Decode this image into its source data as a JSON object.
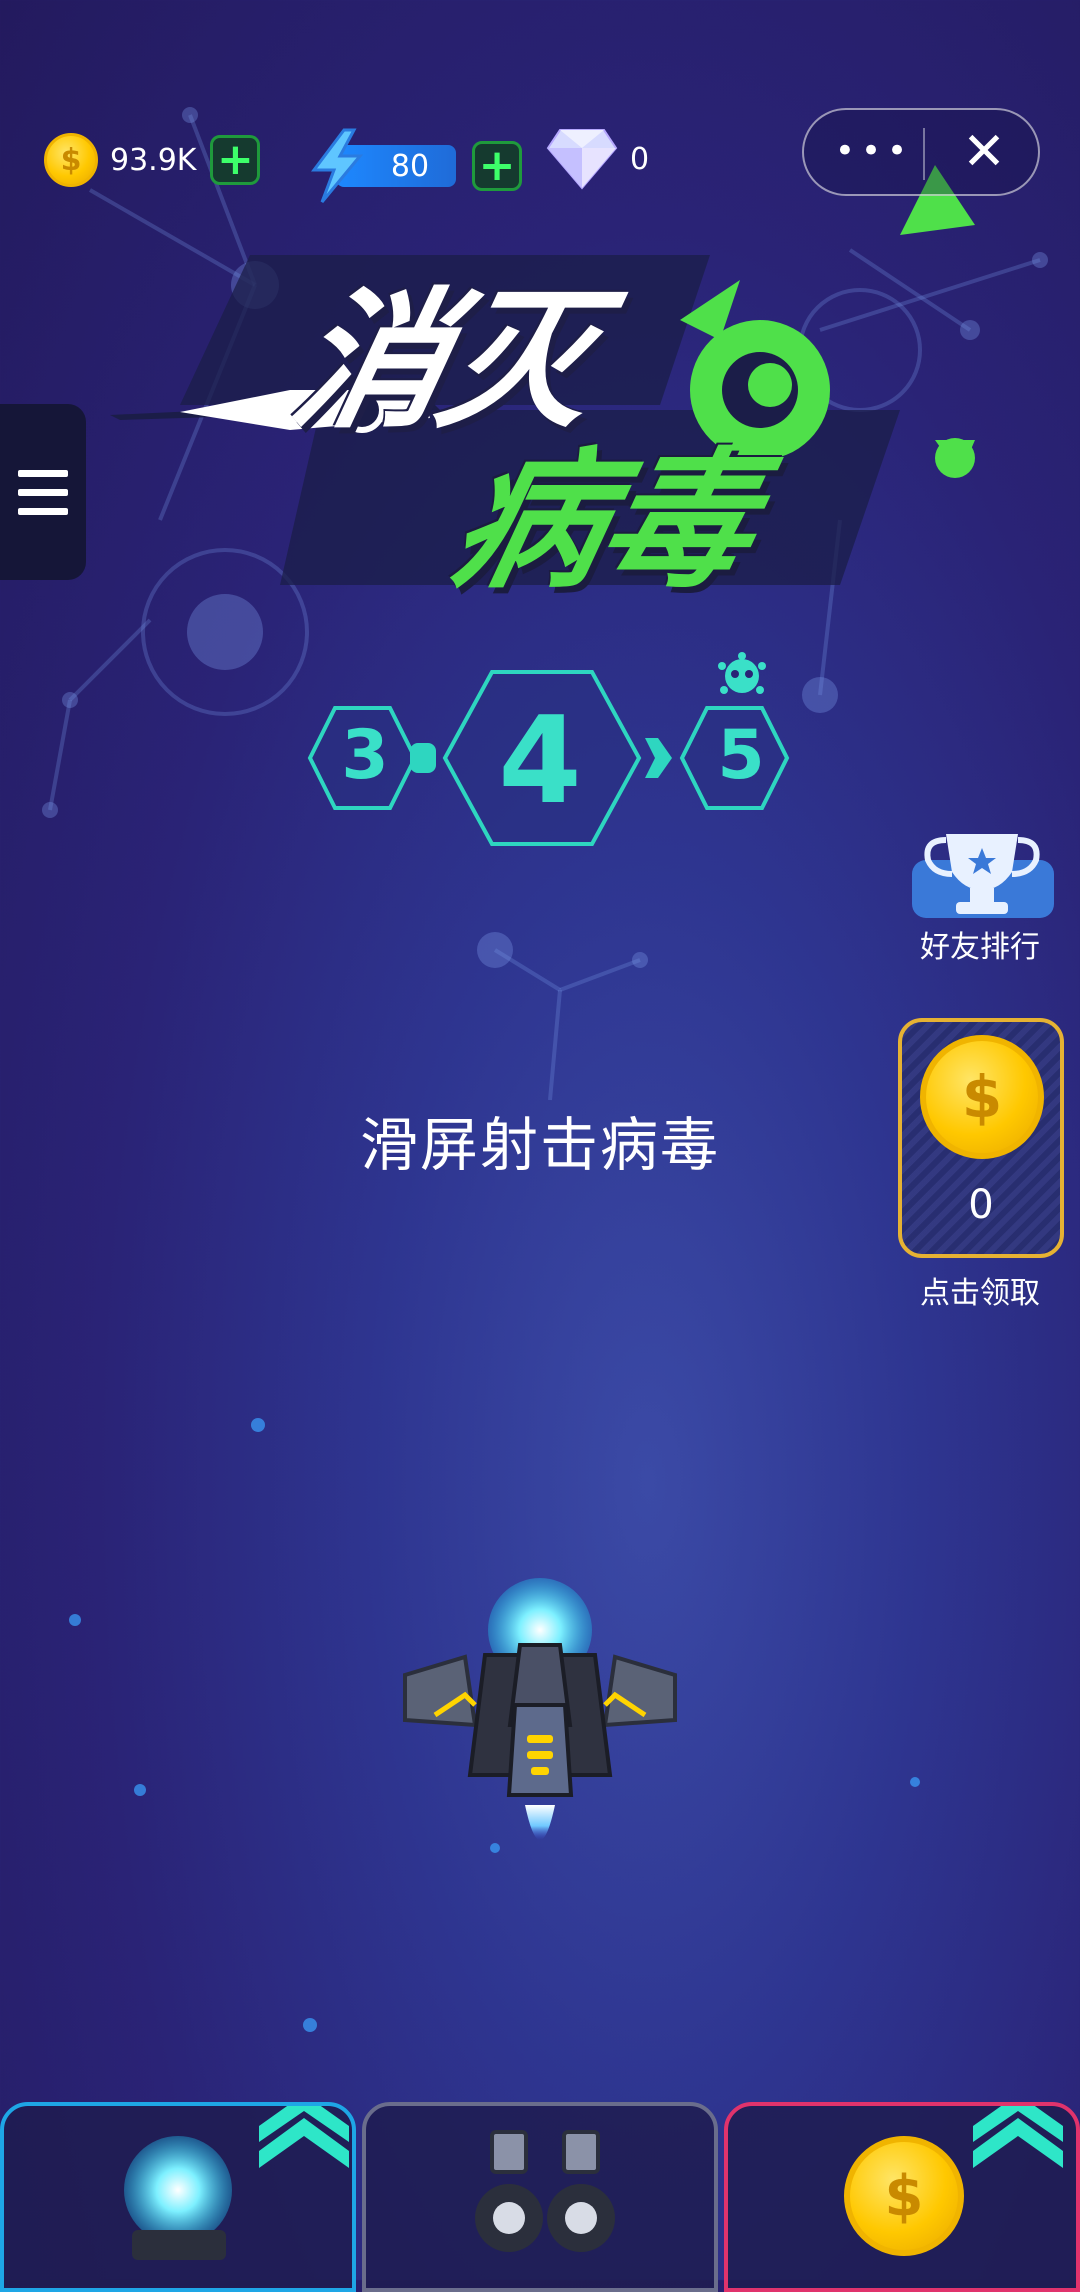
{
  "currencies": {
    "coins": "93.9K",
    "energy": "80",
    "diamonds": "0"
  },
  "title": {
    "line1": "消灭",
    "line2": "病毒"
  },
  "levels": {
    "previous": "3",
    "current": "4",
    "next": "5"
  },
  "hint": "滑屏射击病毒",
  "side": {
    "rank_label": "好友排行",
    "claim_count": "0",
    "claim_label": "点击领取"
  },
  "coin_symbol": "$",
  "colors": {
    "accent_green": "#4fe04a",
    "level_teal": "#3ae0c8",
    "slot_left": "#1ea6e6",
    "slot_center": "#6a6d8c",
    "slot_right": "#e0336c",
    "gold": "#ffc800"
  },
  "icons": {
    "menu": "hamburger-icon",
    "more": "more-dots-icon",
    "close": "close-icon",
    "energy": "lightning-icon",
    "diamond": "diamond-icon",
    "trophy": "trophy-icon",
    "virus": "virus-icon"
  }
}
